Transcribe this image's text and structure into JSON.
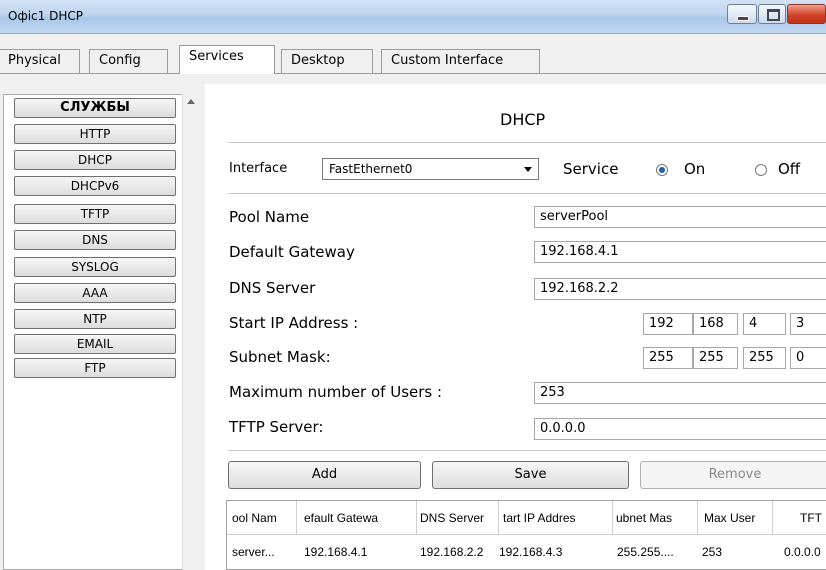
{
  "window": {
    "title": "Офіс1 DHCP"
  },
  "tabs": [
    "Physical",
    "Config",
    "Services",
    "Desktop",
    "Custom Interface"
  ],
  "active_tab": "Services",
  "sidebar": {
    "header": "СЛУЖБЫ",
    "items": [
      "HTTP",
      "DHCP",
      "DHCPv6",
      "TFTP",
      "DNS",
      "SYSLOG",
      "AAA",
      "NTP",
      "EMAIL",
      "FTP"
    ]
  },
  "dhcp": {
    "title": "DHCP",
    "interface_label": "Interface",
    "interface_value": "FastEthernet0",
    "service_label": "Service",
    "on_label": "On",
    "off_label": "Off",
    "service_state": "On",
    "pool_name_label": "Pool Name",
    "pool_name": "serverPool",
    "gateway_label": "Default Gateway",
    "gateway": "192.168.4.1",
    "dns_label": "DNS Server",
    "dns": "192.168.2.2",
    "start_ip_label": "Start IP Address :",
    "start_ip": [
      "192",
      "168",
      "4",
      "3"
    ],
    "mask_label": "Subnet Mask:",
    "mask": [
      "255",
      "255",
      "255",
      "0"
    ],
    "max_users_label": "Maximum number of Users :",
    "max_users": "253",
    "tftp_label": "TFTP Server:",
    "tftp": "0.0.0.0"
  },
  "buttons": {
    "add": "Add",
    "save": "Save",
    "remove": "Remove"
  },
  "table": {
    "columns": [
      "ool Nam",
      "efault Gatewa",
      "DNS Server",
      "tart IP Addres",
      "ubnet Mas",
      "Max User",
      "TFT"
    ],
    "rows": [
      [
        "server...",
        "192.168.4.1",
        "192.168.2.2",
        "192.168.4.3",
        "255.255....",
        "253",
        "0.0.0.0"
      ]
    ]
  }
}
